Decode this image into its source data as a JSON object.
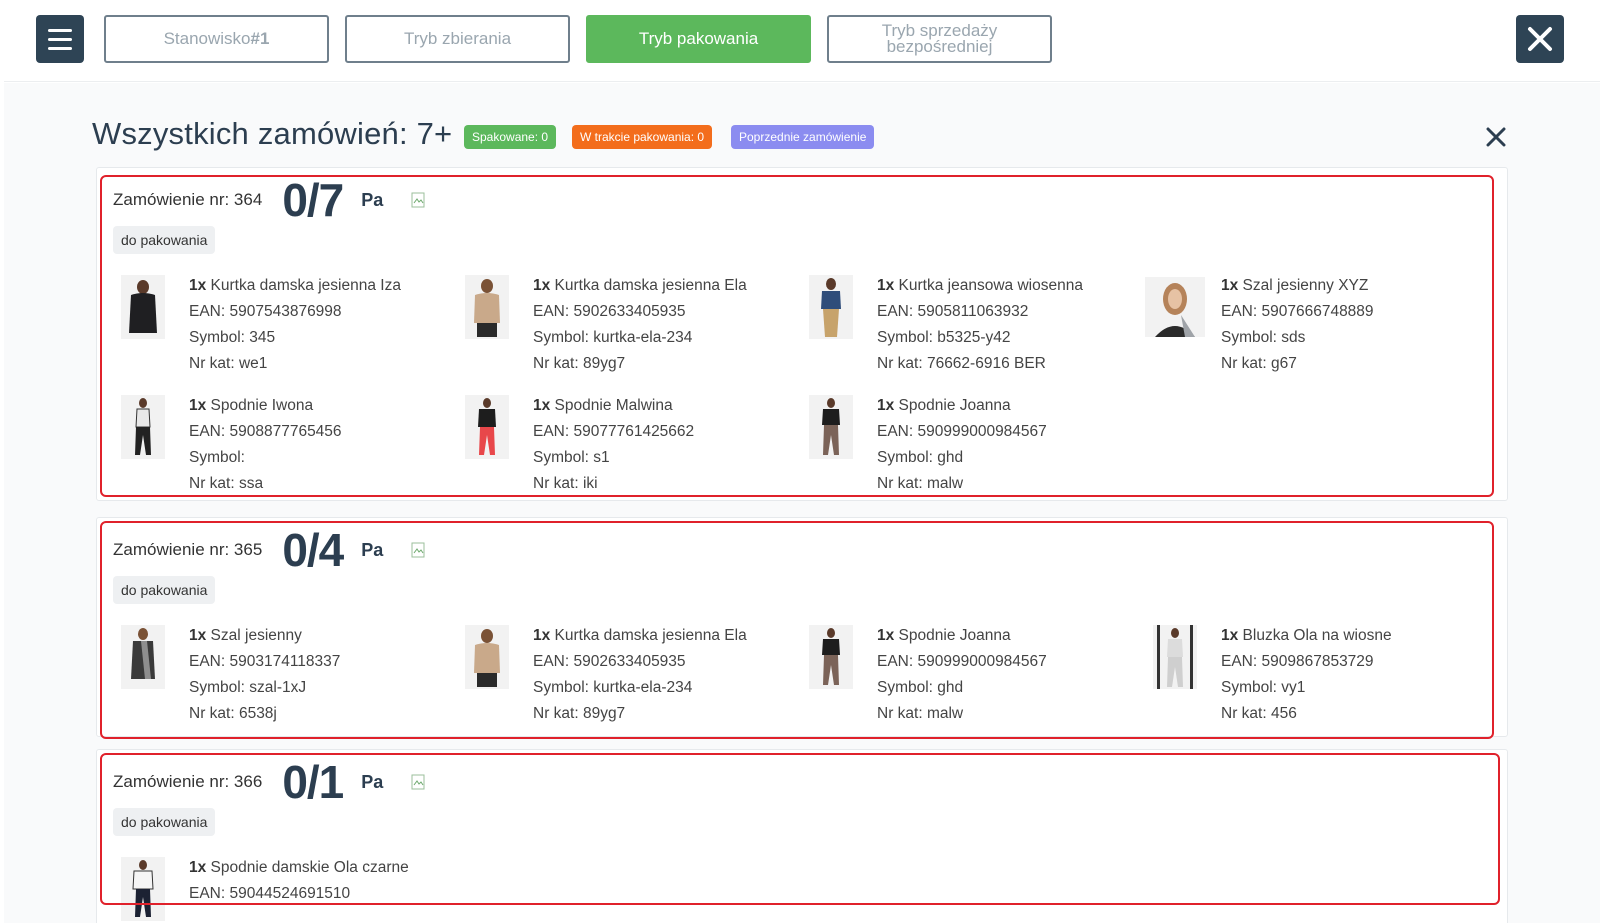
{
  "topbar": {
    "station_prefix": "Stanowisko",
    "station_number": "#1",
    "mode_collect": "Tryb zbierania",
    "mode_pack": "Tryb pakowania",
    "mode_direct_line1": "Tryb sprzedaży",
    "mode_direct_line2": "bezpośredniej",
    "accent_color": "#5cb85c",
    "dark_color": "#2e4455"
  },
  "header": {
    "title": "Wszystkich zamówień: 7+",
    "badge_packed": "Spakowane:  0",
    "badge_in_progress": "W trakcie pakowania:  0",
    "badge_previous": "Poprzednie zamówienie"
  },
  "orders": [
    {
      "label": "Zamówienie nr: 364",
      "count": "0/7",
      "pa": "Pa",
      "status": "do pakowania",
      "items": [
        {
          "qty": "1x",
          "name": " Kurtka damska jesienna Iza",
          "ean": "EAN: 5907543876998",
          "symbol": "Symbol: 345",
          "nrkat": "Nr kat: we1"
        },
        {
          "qty": "1x",
          "name": " Kurtka damska jesienna Ela",
          "ean": "EAN: 5902633405935",
          "symbol": "Symbol: kurtka-ela-234",
          "nrkat": "Nr kat: 89yg7"
        },
        {
          "qty": "1x",
          "name": " Kurtka jeansowa wiosenna",
          "ean": "EAN: 5905811063932",
          "symbol": "Symbol: b5325-y42",
          "nrkat": "Nr kat: 76662-6916 BER"
        },
        {
          "qty": "1x",
          "name": " Szal jesienny XYZ",
          "ean": "EAN: 5907666748889",
          "symbol": "Symbol: sds",
          "nrkat": "Nr kat: g67"
        },
        {
          "qty": "1x",
          "name": " Spodnie Iwona",
          "ean": "EAN: 5908877765456",
          "symbol": "Symbol:",
          "nrkat": "Nr kat: ssa"
        },
        {
          "qty": "1x",
          "name": " Spodnie Malwina",
          "ean": "EAN: 59077761425662",
          "symbol": "Symbol: s1",
          "nrkat": "Nr kat: iki"
        },
        {
          "qty": "1x",
          "name": " Spodnie Joanna",
          "ean": "EAN: 590999000984567",
          "symbol": "Symbol: ghd",
          "nrkat": "Nr kat: malw"
        }
      ]
    },
    {
      "label": "Zamówienie nr: 365",
      "count": "0/4",
      "pa": "Pa",
      "status": "do pakowania",
      "items": [
        {
          "qty": "1x",
          "name": " Szal jesienny",
          "ean": "EAN: 5903174118337",
          "symbol": "Symbol: szal-1xJ",
          "nrkat": "Nr kat: 6538j"
        },
        {
          "qty": "1x",
          "name": " Kurtka damska jesienna Ela",
          "ean": "EAN: 5902633405935",
          "symbol": "Symbol: kurtka-ela-234",
          "nrkat": "Nr kat: 89yg7"
        },
        {
          "qty": "1x",
          "name": " Spodnie Joanna",
          "ean": "EAN: 590999000984567",
          "symbol": "Symbol: ghd",
          "nrkat": "Nr kat: malw"
        },
        {
          "qty": "1x",
          "name": " Bluzka Ola na wiosne",
          "ean": "EAN: 5909867853729",
          "symbol": "Symbol: vy1",
          "nrkat": "Nr kat: 456"
        }
      ]
    },
    {
      "label": "Zamówienie nr: 366",
      "count": "0/1",
      "pa": "Pa",
      "status": "do pakowania",
      "items": [
        {
          "qty": "1x",
          "name": " Spodnie damskie Ola czarne",
          "ean": "EAN: 59044524691510",
          "symbol": "",
          "nrkat": ""
        }
      ]
    }
  ]
}
